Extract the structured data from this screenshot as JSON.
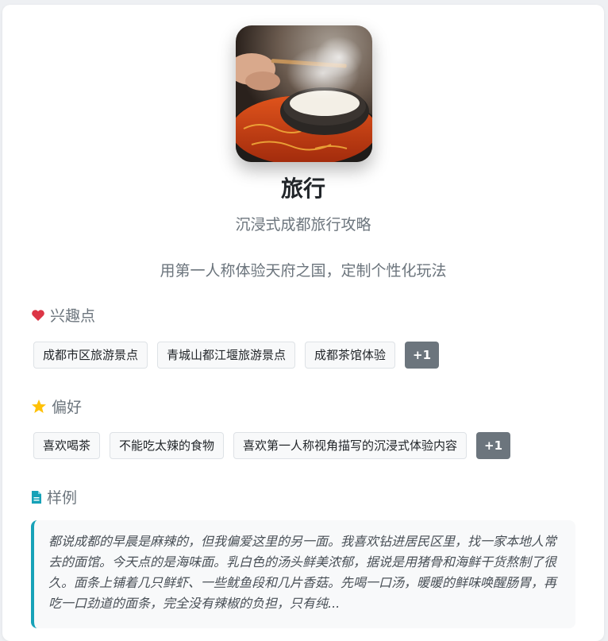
{
  "profile": {
    "title": "旅行",
    "subtitle": "沉浸式成都旅行攻略",
    "description": "用第一人称体验天府之国，定制个性化玩法",
    "cover_image": "hotpot-photo"
  },
  "interests": {
    "heading": "兴趣点",
    "icon": "heart-icon",
    "tags": [
      "成都市区旅游景点",
      "青城山都江堰旅游景点",
      "成都茶馆体验"
    ],
    "more_label": "+1"
  },
  "preferences": {
    "heading": "偏好",
    "icon": "star-icon",
    "tags": [
      "喜欢喝茶",
      "不能吃太辣的食物",
      "喜欢第一人称视角描写的沉浸式体验内容"
    ],
    "more_label": "+1"
  },
  "example": {
    "heading": "样例",
    "icon": "document-icon",
    "text": "都说成都的早晨是麻辣的，但我偏爱这里的另一面。我喜欢钻进居民区里，找一家本地人常去的面馆。今天点的是海味面。乳白色的汤头鲜美浓郁，据说是用猪骨和海鲜干货熬制了很久。面条上铺着几只鲜虾、一些鱿鱼段和几片香菇。先喝一口汤，暖暖的鲜味唤醒肠胃，再吃一口劲道的面条，完全没有辣椒的负担，只有纯..."
  },
  "colors": {
    "heart": "#dc3545",
    "star": "#ffc107",
    "document": "#17a2b8",
    "muted_text": "#6c757d",
    "more_badge": "#6c757d"
  }
}
